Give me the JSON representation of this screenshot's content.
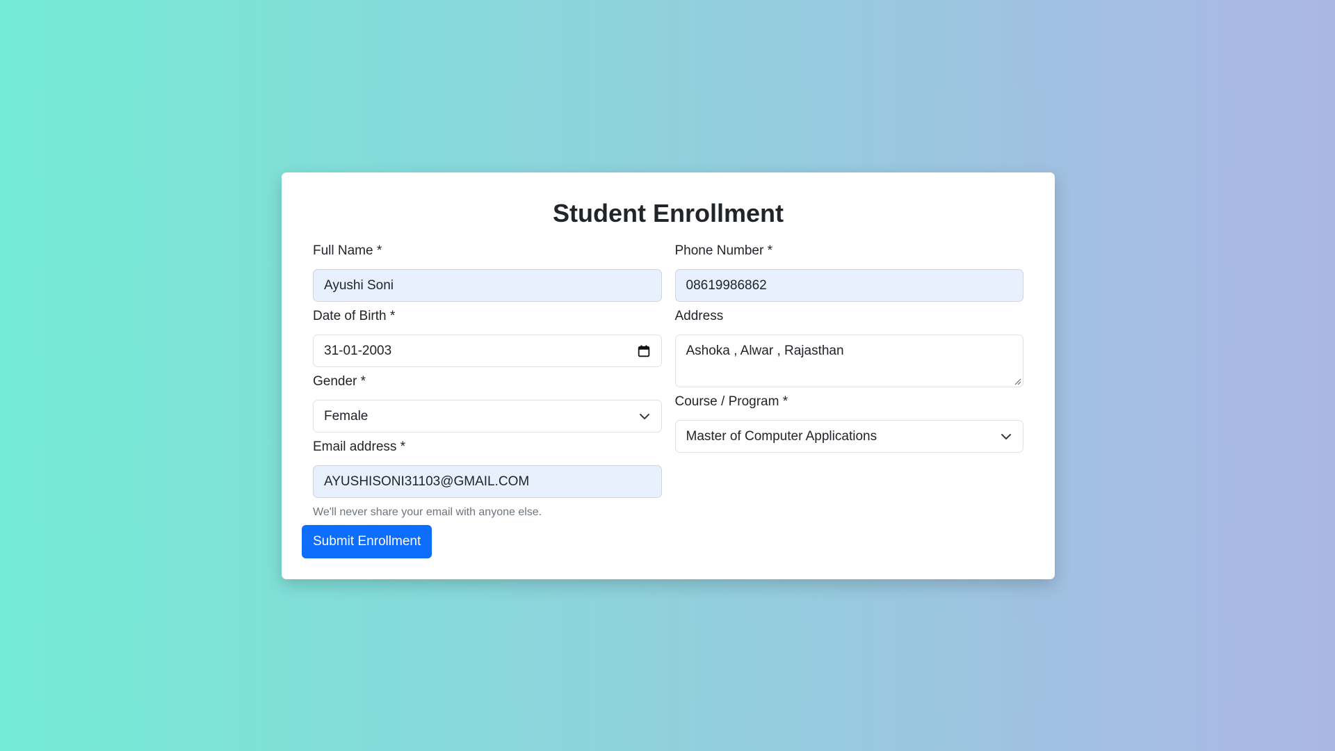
{
  "form": {
    "title": "Student Enrollment",
    "full_name": {
      "label": "Full Name *",
      "value": "Ayushi Soni"
    },
    "phone": {
      "label": "Phone Number *",
      "value": "08619986862"
    },
    "dob": {
      "label": "Date of Birth *",
      "value": "31-01-2003",
      "icon": "calendar-icon"
    },
    "address": {
      "label": "Address",
      "value": "Ashoka , Alwar , Rajasthan"
    },
    "gender": {
      "label": "Gender *",
      "value": "Female",
      "icon": "chevron-down-icon"
    },
    "course": {
      "label": "Course / Program *",
      "value": "Master of Computer Applications",
      "icon": "chevron-down-icon"
    },
    "email": {
      "label": "Email address *",
      "value": "AYUSHISONI31103@GMAIL.COM",
      "help": "We'll never share your email with anyone else."
    },
    "submit_label": "Submit Enrollment"
  },
  "colors": {
    "accent": "#0d6efd",
    "autofill": "#e8f0fe",
    "background_start": "#74ebd5",
    "background_end": "#acb6e5"
  }
}
